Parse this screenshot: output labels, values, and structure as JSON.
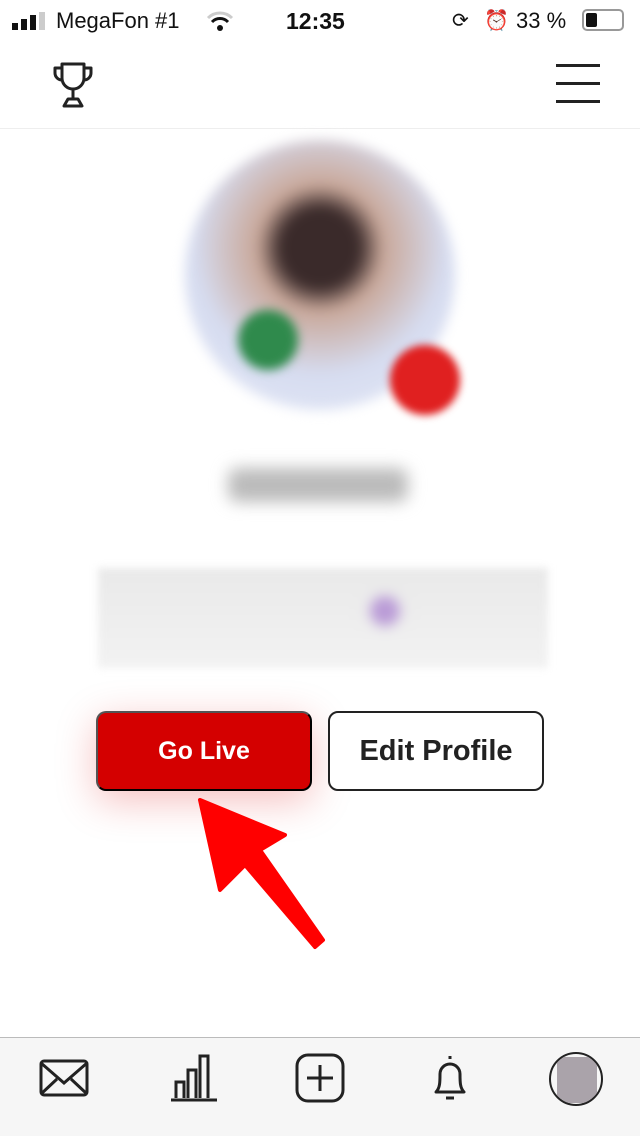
{
  "status_bar": {
    "carrier": "MegaFon #1",
    "time": "12:35",
    "battery": "33 %",
    "battery_level": 0.33,
    "icons": [
      "signal-icon",
      "wifi-icon",
      "orientation-lock-icon",
      "alarm-icon",
      "battery-icon"
    ]
  },
  "header": {
    "left_icon": "trophy-icon",
    "right_icon": "menu-icon"
  },
  "profile": {
    "go_live_label": "Go Live",
    "edit_profile_label": "Edit Profile"
  },
  "colors": {
    "accent": "#d40000",
    "arrow": "#ff0000"
  },
  "tabbar": {
    "icons": [
      "mail-icon",
      "stats-icon",
      "add-icon",
      "bell-icon",
      "profile-avatar"
    ]
  }
}
